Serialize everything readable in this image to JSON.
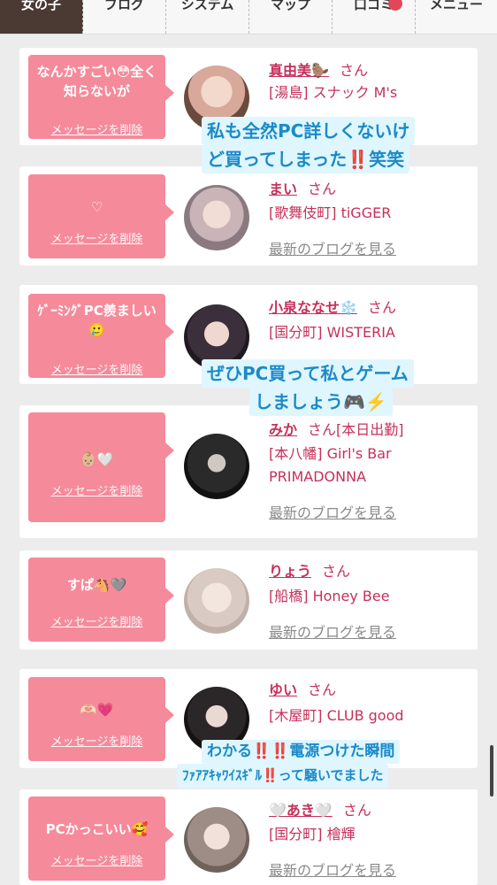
{
  "nav": {
    "tabs": [
      {
        "label": "女の子",
        "active": true
      },
      {
        "label": "ブログ",
        "active": false
      },
      {
        "label": "システム",
        "active": false
      },
      {
        "label": "マップ",
        "active": false
      },
      {
        "label": "口コミ",
        "active": false
      },
      {
        "label": "メニュー",
        "active": false
      }
    ]
  },
  "delete_label": "メッセージを削除",
  "san": "さん",
  "blog_link": "最新のブログを見る",
  "cards": [
    {
      "message": "なんかすごい😳全く知らないが",
      "name": "真由美🦫",
      "shop": "[湯島] スナック M's",
      "has_blog": false
    },
    {
      "message": "♡",
      "name": "まい",
      "shop": "[歌舞伎町] tiGGER",
      "has_blog": true
    },
    {
      "message": "ｹﾞｰﾐﾝｸﾞPC羨ましい🥲",
      "name": "小泉ななせ❄️",
      "shop": "[国分町] WISTERIA",
      "has_blog": false
    },
    {
      "message": "👶🏼🤍",
      "name": "みか",
      "name_extra": "[本日出勤]",
      "shop": "[本八幡] Girl's Bar PRIMADONNA",
      "has_blog": true
    },
    {
      "message": "すぱ🐴🩶",
      "name": "りょう",
      "shop": "[船橋] Honey Bee",
      "has_blog": true
    },
    {
      "message": "🫶🏻💗",
      "name": "ゆい",
      "shop": "[木屋町] CLUB good",
      "has_blog": false
    },
    {
      "message": "PCかっこいい🥰",
      "name": "🤍あき🤍",
      "shop": "[国分町] 檜輝",
      "has_blog": true
    }
  ],
  "overlays": [
    {
      "text": "私も全然PC詳しくないけ"
    },
    {
      "text": "ど買ってしまった‼️笑笑"
    },
    {
      "text": "ぜひPC買って私とゲーム"
    },
    {
      "text": "しましょう🎮⚡️"
    },
    {
      "text": "わかる‼️‼️電源つけた瞬間"
    },
    {
      "text": "ﾌｧｱｱｷｬﾜｲｽｷﾞﾙ‼️って騒いでました"
    }
  ],
  "colors": {
    "accent": "#c6305a",
    "bubble": "#f58a9b",
    "nav_active": "#4a3a33",
    "overlay_text": "#1b8ac8",
    "overlay_bg": "#dff6ff"
  }
}
